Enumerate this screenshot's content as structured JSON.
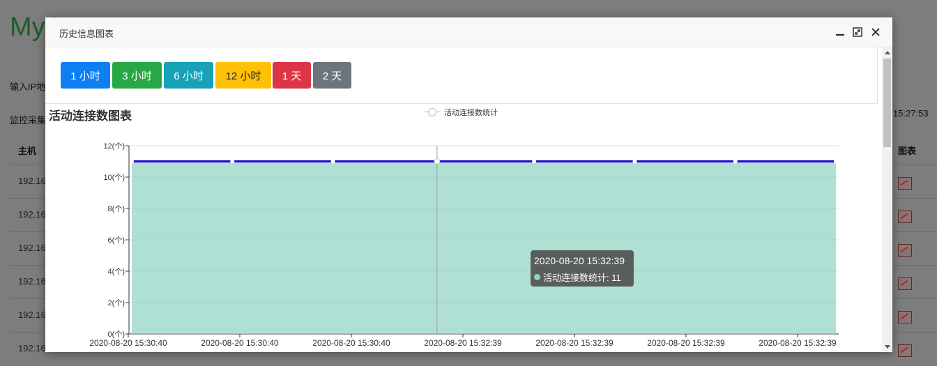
{
  "background": {
    "logo_text": "MyS",
    "ip_label": "输入IP地",
    "monitor_label": "监控采集",
    "time_right": "15:27:53",
    "col_host": "主机",
    "col_chart": "图表",
    "row_hosts": [
      "192.16",
      "192.16",
      "192.16",
      "192.16",
      "192.16",
      "192.16"
    ]
  },
  "modal": {
    "title": "历史信息图表",
    "header_icons": [
      "minimize-icon",
      "maximize-icon",
      "close-icon"
    ],
    "buttons": [
      {
        "label": "1 小时",
        "color": "#0d7ff3"
      },
      {
        "label": "3 小时",
        "color": "#27a745"
      },
      {
        "label": "6 小时",
        "color": "#17a2b8"
      },
      {
        "label": "12 小时",
        "color": "#ffc107"
      },
      {
        "label": "1 天",
        "color": "#dc3545"
      },
      {
        "label": "2 天",
        "color": "#6c757d"
      }
    ]
  },
  "chart_data": {
    "type": "area",
    "title": "活动连接数图表",
    "series": [
      {
        "name": "活动连接数统计",
        "color": "#8fd3c1",
        "line_color": "#2200dd",
        "values": [
          11,
          11,
          11,
          11,
          11,
          11,
          11,
          11
        ]
      }
    ],
    "x_tick_labels": [
      "2020-08-20 15:30:40",
      "2020-08-20 15:30:40",
      "2020-08-20 15:30:40",
      "2020-08-20 15:32:39",
      "2020-08-20 15:32:39",
      "2020-08-20 15:32:39",
      "2020-08-20 15:32:39"
    ],
    "y_tick_labels": [
      "0(个)",
      "2(个)",
      "4(个)",
      "6(个)",
      "8(个)",
      "10(个)",
      "12(个)"
    ],
    "ylim": [
      0,
      12
    ],
    "grid": true,
    "legend_position": "top-center",
    "tooltip": {
      "time": "2020-08-20 15:32:39",
      "series_label": "活动连接数统计",
      "value": "11",
      "text": "活动连接数统计: 11"
    }
  }
}
